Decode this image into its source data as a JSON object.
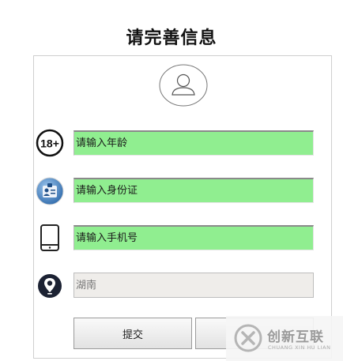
{
  "page": {
    "title": "请完善信息"
  },
  "form": {
    "age": {
      "placeholder": "请输入年龄",
      "value": ""
    },
    "id_card": {
      "placeholder": "请输入身份证",
      "value": ""
    },
    "phone": {
      "placeholder": "请输入手机号",
      "value": ""
    },
    "location": {
      "placeholder": "湖南",
      "value": ""
    },
    "age_badge": "18+"
  },
  "actions": {
    "submit_label": "提交"
  },
  "watermark": {
    "brand": "创新互联",
    "sub": "CHUANG XIN HU LIAN"
  },
  "colors": {
    "field_bg": "#90ee90",
    "disabled_bg": "#efedea",
    "pin": "#1c2233",
    "id_badge": "#4a86c5"
  },
  "icons": [
    "avatar-icon",
    "age-18-plus-icon",
    "id-card-icon",
    "tablet-phone-icon",
    "location-pin-icon",
    "watermark-logo-icon"
  ]
}
